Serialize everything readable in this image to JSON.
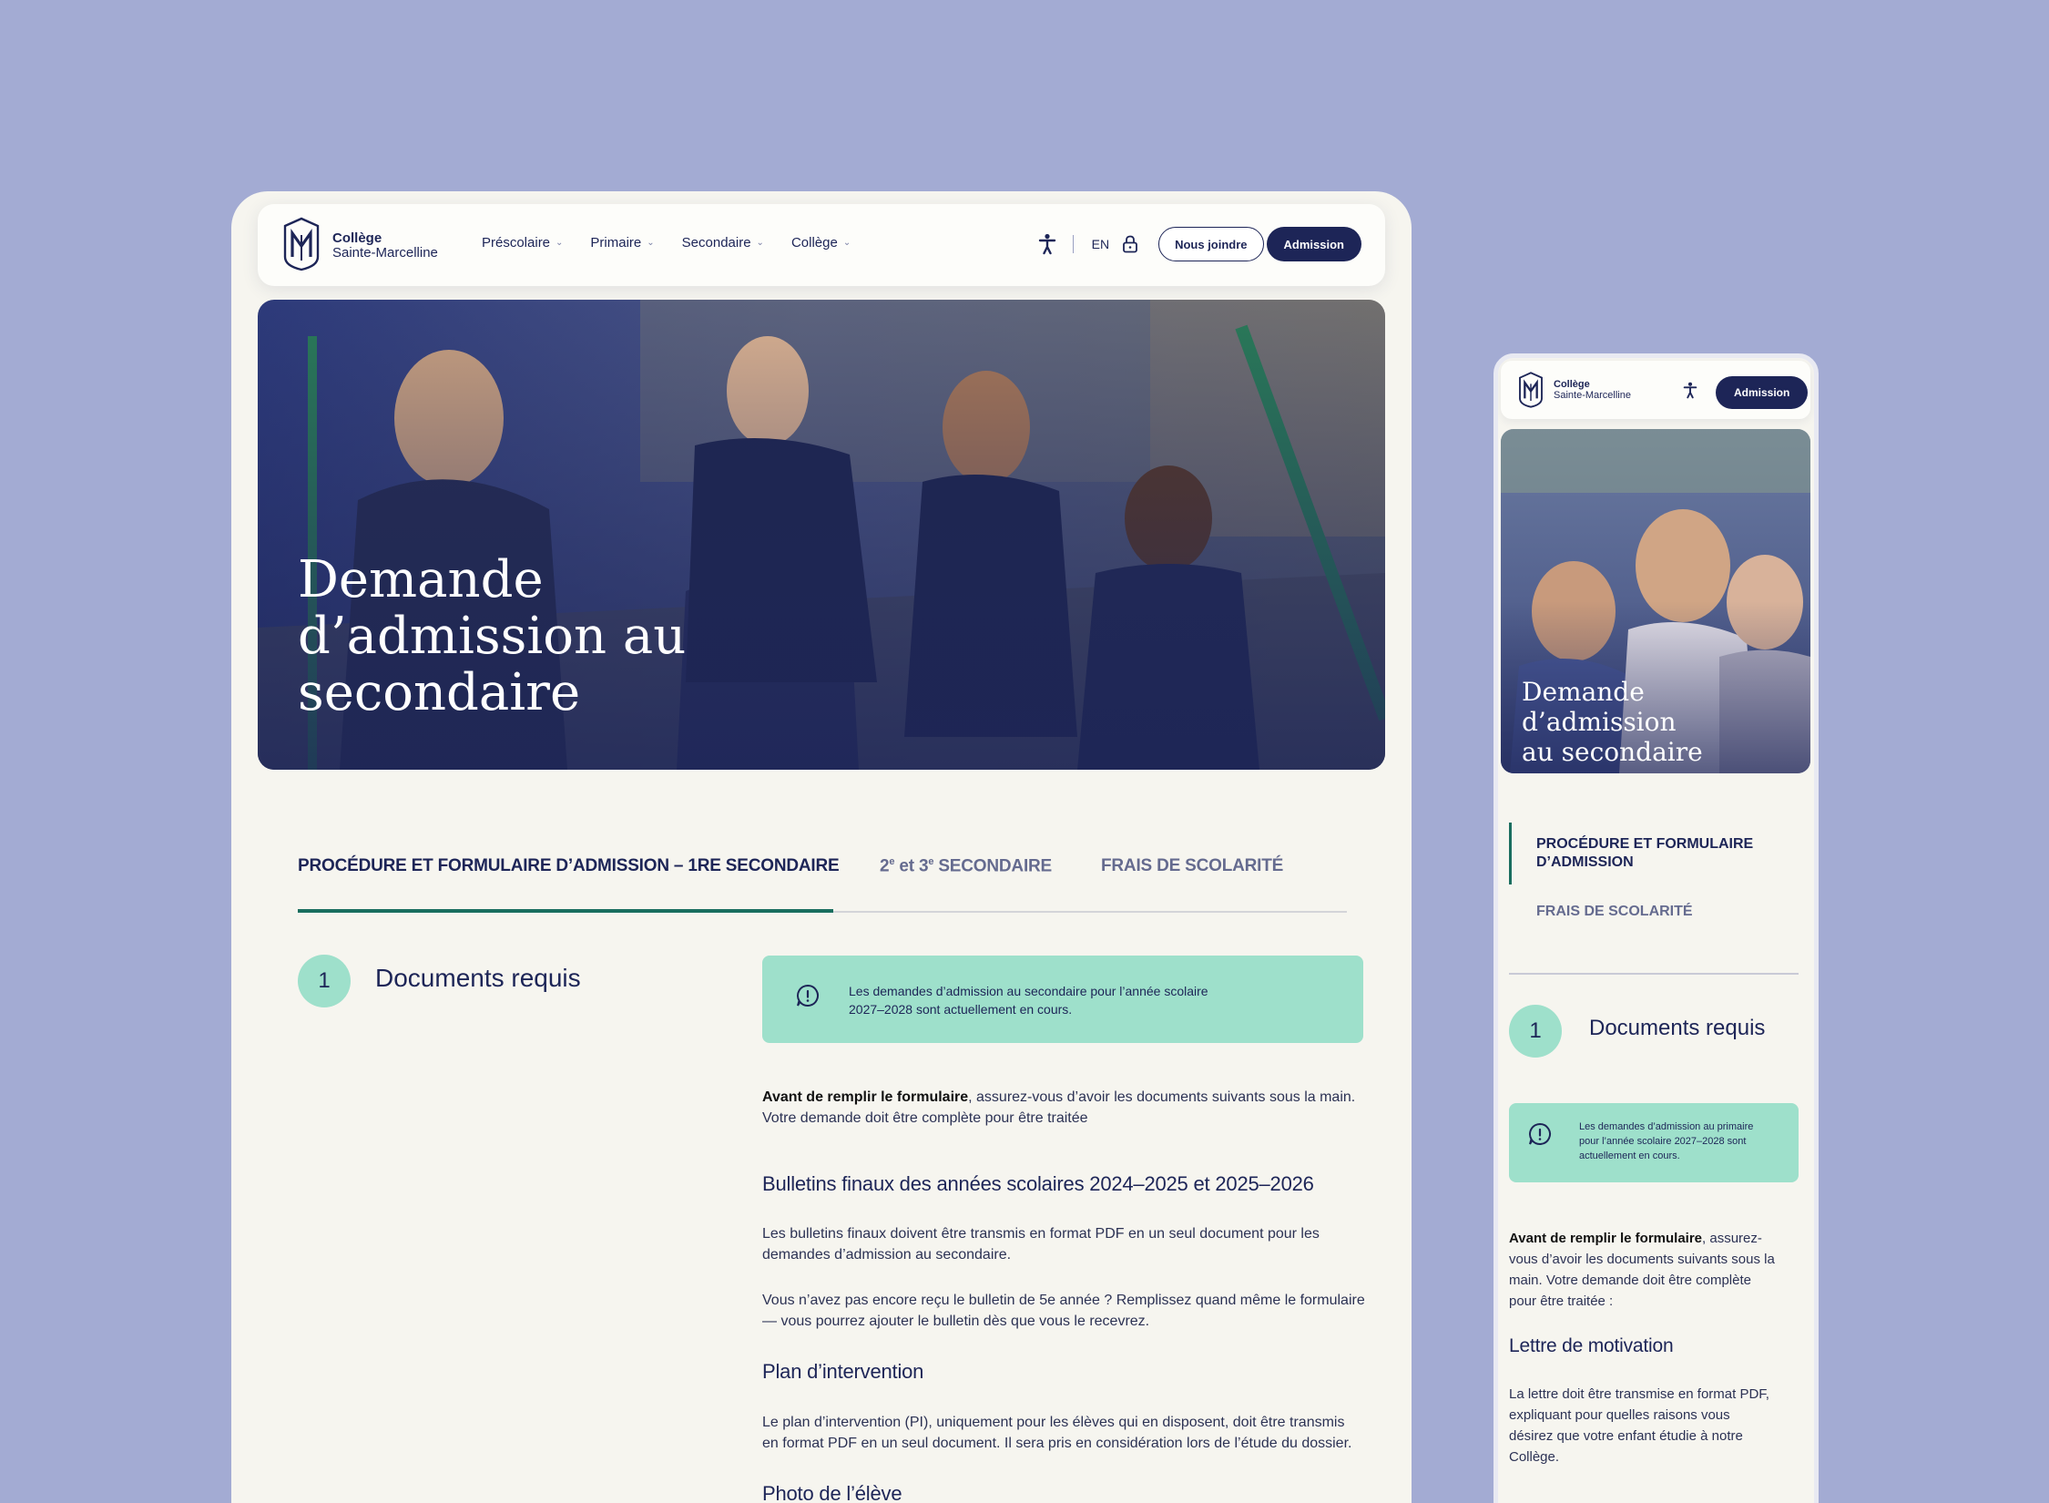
{
  "brand": {
    "line1": "Collège",
    "line2": "Sainte-Marcelline"
  },
  "desktop": {
    "nav": {
      "menu": [
        {
          "label": "Préscolaire"
        },
        {
          "label": "Primaire"
        },
        {
          "label": "Secondaire"
        },
        {
          "label": "Collège"
        }
      ],
      "lang": "EN",
      "contact_label": "Nous joindre",
      "admission_label": "Admission"
    },
    "hero": {
      "line1": "Demande",
      "line2": "d’admission au",
      "line3": "secondaire"
    },
    "tabs": [
      {
        "label": "PROCÉDURE ET FORMULAIRE D’ADMISSION – 1RE SECONDAIRE",
        "active": true
      },
      {
        "label": "2e et 3e SECONDAIRE",
        "active": false
      },
      {
        "label": "FRAIS DE SCOLARITÉ",
        "active": false
      }
    ],
    "step": {
      "number": "1",
      "title": "Documents requis"
    },
    "notice": {
      "line1": "Les demandes d’admission au secondaire pour l’année scolaire",
      "line2": "2027–2028 sont actuellement en cours."
    },
    "intro": {
      "bold": "Avant de remplir le formulaire",
      "rest1": ", assurez-vous d’avoir les documents suivants sous la main.",
      "line2": "Votre demande doit être complète pour être traitée"
    },
    "sections": {
      "bulletins_title": "Bulletins finaux des années scolaires 2024–2025 et 2025–2026",
      "bulletins_p1_l1": "Les bulletins finaux doivent être transmis en format PDF en un seul document pour les",
      "bulletins_p1_l2": "demandes d’admission au secondaire.",
      "bulletins_p2_l1": "Vous n’avez pas encore reçu le bulletin de 5e année ? Remplissez quand même le formulaire",
      "bulletins_p2_l2": "— vous pourrez ajouter le bulletin dès que vous le recevrez.",
      "plan_title": "Plan d’intervention",
      "plan_l1": "Le plan d’intervention (PI), uniquement pour les élèves qui en disposent, doit être transmis",
      "plan_l2": "en format PDF en un seul document. Il sera pris en considération lors de l’étude du dossier.",
      "photo_title": "Photo de l’élève"
    }
  },
  "mobile": {
    "nav": {
      "admission_label": "Admission"
    },
    "hero": {
      "line1": "Demande d’admission",
      "line2": "au secondaire"
    },
    "tabs": {
      "active_l1": "PROCÉDURE ET FORMULAIRE",
      "active_l2": "D’ADMISSION",
      "inactive": "FRAIS DE SCOLARITÉ"
    },
    "step": {
      "number": "1",
      "title": "Documents requis"
    },
    "notice": {
      "l1": "Les demandes d’admission au primaire",
      "l2": "pour l’année scolaire 2027–2028 sont",
      "l3": "actuellement en cours."
    },
    "intro": {
      "bold": "Avant de remplir le formulaire",
      "l1rest": ", assurez-",
      "l2": "vous d’avoir les documents suivants sous la",
      "l3": "main. Votre demande doit être complète",
      "l4": "pour être traitée :"
    },
    "letter_title": "Lettre de motivation",
    "letter": {
      "l1": "La lettre doit être transmise en format PDF,",
      "l2": "expliquant pour quelles raisons vous",
      "l3": "désirez que votre enfant étudie à notre",
      "l4": "Collège."
    }
  },
  "colors": {
    "navy": "#1d2557",
    "mint": "#9ee0cb",
    "green": "#1a6e5f",
    "backdrop": "#a3abd3"
  }
}
